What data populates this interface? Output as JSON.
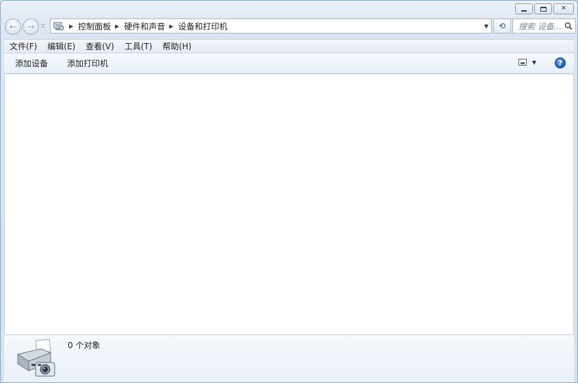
{
  "window": {
    "caption_buttons": {
      "minimize_icon": "minimize-icon",
      "maximize_icon": "maximize-icon",
      "close_label": "✕"
    }
  },
  "navigation": {
    "back_label": "←",
    "forward_label": "→",
    "history_label": "▽",
    "breadcrumbs": [
      "控制面板",
      "硬件和声音",
      "设备和打印机"
    ],
    "separator": "▶",
    "dropdown_label": "▼",
    "refresh_label": "⟲",
    "search_placeholder": "搜索 设备..."
  },
  "menu": {
    "items": [
      "文件(F)",
      "编辑(E)",
      "查看(V)",
      "工具(T)",
      "帮助(H)"
    ]
  },
  "commands": {
    "add_device": "添加设备",
    "add_printer": "添加打印机",
    "view_arrow": "▼",
    "help_label": "?"
  },
  "details": {
    "count": "0 个对象",
    "icon": "printer-camera-icon"
  },
  "colors": {
    "accent": "#1c5bb0",
    "frame": "#dae5f2"
  }
}
